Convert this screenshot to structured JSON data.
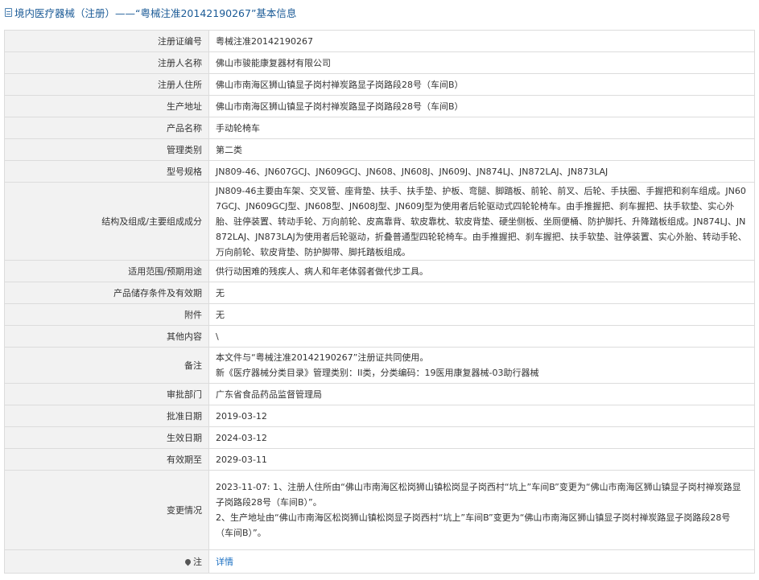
{
  "header": {
    "title": "境内医疗器械（注册）——“粤械注准20142190267”基本信息"
  },
  "rows": [
    {
      "label": "注册证编号",
      "value": "粤械注准20142190267"
    },
    {
      "label": "注册人名称",
      "value": "佛山市骏能康复器材有限公司"
    },
    {
      "label": "注册人住所",
      "value": "佛山市南海区狮山镇显子岗村禅炭路显子岗路段28号（车间B）"
    },
    {
      "label": "生产地址",
      "value": "佛山市南海区狮山镇显子岗村禅炭路显子岗路段28号（车间B）"
    },
    {
      "label": "产品名称",
      "value": "手动轮椅车"
    },
    {
      "label": "管理类别",
      "value": "第二类"
    },
    {
      "label": "型号规格",
      "value": "JN809-46、JN607GCJ、JN609GCJ、JN608、JN608J、JN609J、JN874LJ、JN872LAJ、JN873LAJ"
    },
    {
      "label": "结构及组成/主要组成成分",
      "value": "JN809-46主要由车架、交叉管、座背垫、扶手、扶手垫、护板、弯腿、脚踏板、前轮、前叉、后轮、手扶圈、手握把和刹车组成。JN607GCJ、JN609GCJ型、JN608型、JN608J型、JN609J型为使用者后轮驱动式四轮轮椅车。由手推握把、刹车握把、扶手软垫、实心外胎、驻停装置、转动手轮、万向前轮、皮高靠背、软皮靠枕、软皮背垫、硬坐侧板、坐厕便桶、防护脚托、升降踏板组成。JN874LJ、JN872LAJ、JN873LAJ为使用者后轮驱动，折叠普通型四轮轮椅车。由手推握把、刹车握把、扶手软垫、驻停装置、实心外胎、转动手轮、万向前轮、软皮背垫、防护脚带、脚托踏板组成。"
    },
    {
      "label": "适用范围/预期用途",
      "value": "供行动困难的残疾人、病人和年老体弱者做代步工具。"
    },
    {
      "label": "产品储存条件及有效期",
      "value": "无"
    },
    {
      "label": "附件",
      "value": "无"
    },
    {
      "label": "其他内容",
      "value": "\\"
    },
    {
      "label": "备注",
      "lines": [
        "本文件与“粤械注准20142190267”注册证共同使用。",
        "新《医疗器械分类目录》管理类别：II类，分类编码：19医用康复器械-03助行器械"
      ]
    },
    {
      "label": "审批部门",
      "value": "广东省食品药品监督管理局"
    },
    {
      "label": "批准日期",
      "value": "2019-03-12"
    },
    {
      "label": "生效日期",
      "value": "2024-03-12"
    },
    {
      "label": "有效期至",
      "value": "2029-03-11"
    },
    {
      "label": "变更情况",
      "lines": [
        "2023-11-07: 1、注册人住所由“佛山市南海区松岗狮山镇松岗显子岗西村“坑上”车间B”变更为“佛山市南海区狮山镇显子岗村禅炭路显子岗路段28号（车间B）”。",
        "2、生产地址由“佛山市南海区松岗狮山镇松岗显子岗西村“坑上”车间B”变更为“佛山市南海区狮山镇显子岗村禅炭路显子岗路段28号（车间B）”。"
      ]
    }
  ],
  "note_row": {
    "label": "注",
    "link": "详情"
  }
}
